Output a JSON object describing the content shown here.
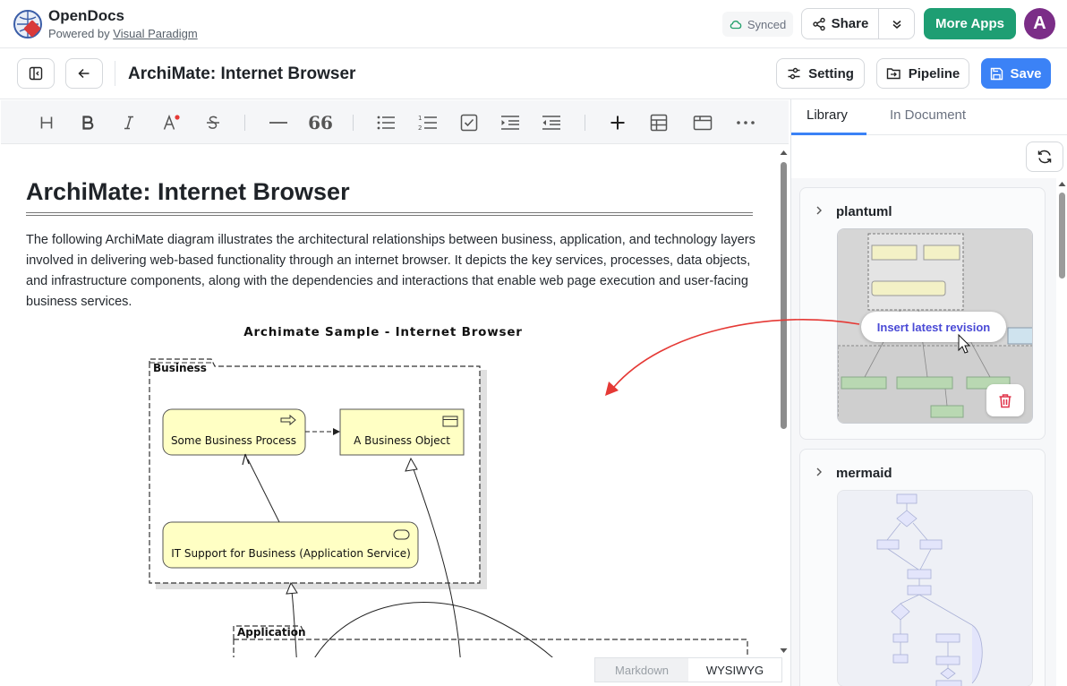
{
  "app": {
    "name": "OpenDocs",
    "powered_prefix": "Powered by",
    "powered_link": "Visual Paradigm"
  },
  "topbar": {
    "sync_status": "Synced",
    "share_label": "Share",
    "more_apps_label": "More Apps",
    "avatar_initial": "A",
    "accent_green": "#1e9e73",
    "avatar_color": "#7b2d87"
  },
  "docbar": {
    "title": "ArchiMate: Internet Browser",
    "setting_label": "Setting",
    "pipeline_label": "Pipeline",
    "save_label": "Save",
    "save_color": "#3b82f6"
  },
  "toolbar": {
    "icons": [
      "heading-icon",
      "bold-icon",
      "italic-icon",
      "font-color-icon",
      "strikethrough-icon",
      "horizontal-rule-icon",
      "quote-icon",
      "bullet-list-icon",
      "ordered-list-icon",
      "task-list-icon",
      "indent-icon",
      "outdent-icon",
      "plus-icon",
      "table-icon",
      "window-icon",
      "more-icon"
    ]
  },
  "document": {
    "heading": "ArchiMate: Internet Browser",
    "paragraph": "The following ArchiMate diagram illustrates the architectural relationships between business, application, and technology layers involved in delivering web-based functionality through an internet browser. It depicts the key services, processes, data objects, and infrastructure components, along with the dependencies and interactions that enable web page execution and user-facing business services.",
    "diagram": {
      "title": "Archimate Sample - Internet Browser",
      "business_group": "Business",
      "process": "Some Business Process",
      "object": "A Business Object",
      "service": "IT Support for Business (Application Service)",
      "application_group": "Application"
    }
  },
  "mode_tabs": {
    "markdown": "Markdown",
    "wysiwyg": "WYSIWYG"
  },
  "panel": {
    "tab_library": "Library",
    "tab_in_document": "In Document",
    "cards": [
      {
        "title": "plantuml"
      },
      {
        "title": "mermaid"
      }
    ],
    "insert_label": "Insert latest revision"
  }
}
